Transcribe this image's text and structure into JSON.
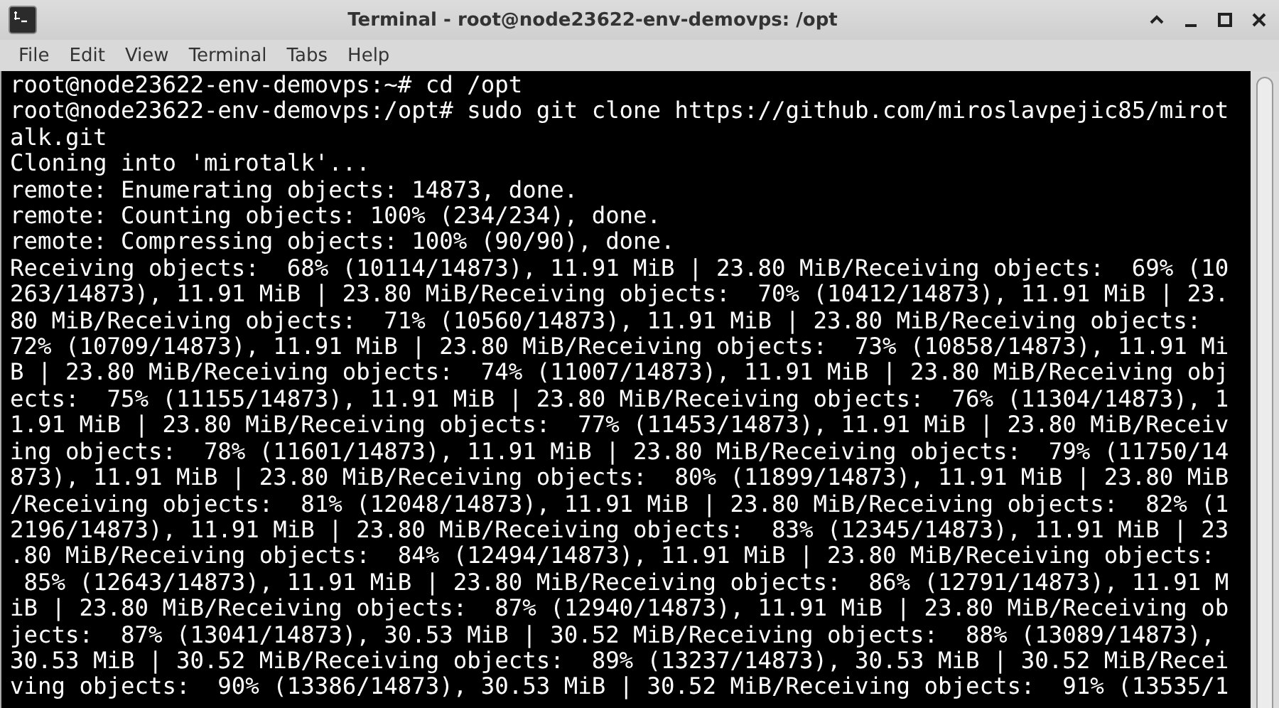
{
  "window": {
    "title": "Terminal - root@node23622-env-demovps: /opt"
  },
  "menu": [
    "File",
    "Edit",
    "View",
    "Terminal",
    "Tabs",
    "Help"
  ],
  "terminal": {
    "lines": [
      "root@node23622-env-demovps:~# cd /opt",
      "root@node23622-env-demovps:/opt# sudo git clone https://github.com/miroslavpejic85/mirot",
      "alk.git",
      "Cloning into 'mirotalk'...",
      "remote: Enumerating objects: 14873, done.",
      "remote: Counting objects: 100% (234/234), done.",
      "remote: Compressing objects: 100% (90/90), done.",
      "Receiving objects:  68% (10114/14873), 11.91 MiB | 23.80 MiB/Receiving objects:  69% (10",
      "263/14873), 11.91 MiB | 23.80 MiB/Receiving objects:  70% (10412/14873), 11.91 MiB | 23.",
      "80 MiB/Receiving objects:  71% (10560/14873), 11.91 MiB | 23.80 MiB/Receiving objects:",
      "72% (10709/14873), 11.91 MiB | 23.80 MiB/Receiving objects:  73% (10858/14873), 11.91 Mi",
      "B | 23.80 MiB/Receiving objects:  74% (11007/14873), 11.91 MiB | 23.80 MiB/Receiving obj",
      "ects:  75% (11155/14873), 11.91 MiB | 23.80 MiB/Receiving objects:  76% (11304/14873), 1",
      "1.91 MiB | 23.80 MiB/Receiving objects:  77% (11453/14873), 11.91 MiB | 23.80 MiB/Receiv",
      "ing objects:  78% (11601/14873), 11.91 MiB | 23.80 MiB/Receiving objects:  79% (11750/14",
      "873), 11.91 MiB | 23.80 MiB/Receiving objects:  80% (11899/14873), 11.91 MiB | 23.80 MiB",
      "/Receiving objects:  81% (12048/14873), 11.91 MiB | 23.80 MiB/Receiving objects:  82% (1",
      "2196/14873), 11.91 MiB | 23.80 MiB/Receiving objects:  83% (12345/14873), 11.91 MiB | 23",
      ".80 MiB/Receiving objects:  84% (12494/14873), 11.91 MiB | 23.80 MiB/Receiving objects:",
      " 85% (12643/14873), 11.91 MiB | 23.80 MiB/Receiving objects:  86% (12791/14873), 11.91 M",
      "iB | 23.80 MiB/Receiving objects:  87% (12940/14873), 11.91 MiB | 23.80 MiB/Receiving ob",
      "jects:  87% (13041/14873), 30.53 MiB | 30.52 MiB/Receiving objects:  88% (13089/14873),",
      "30.53 MiB | 30.52 MiB/Receiving objects:  89% (13237/14873), 30.53 MiB | 30.52 MiB/Recei",
      "ving objects:  90% (13386/14873), 30.53 MiB | 30.52 MiB/Receiving objects:  91% (13535/1"
    ]
  }
}
